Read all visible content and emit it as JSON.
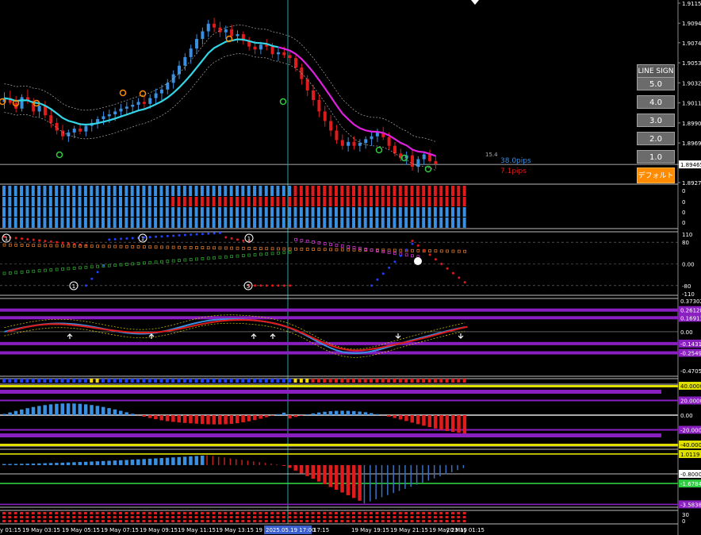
{
  "colors": {
    "background": "#000000",
    "bull": "#3a8fe0",
    "bear": "#e01b1b",
    "ma_fast": "#33d6e6",
    "ma_slow": "#e020e0",
    "crosshair": "#2fa0a0"
  },
  "price_axis": {
    "ticks": [
      "1.91155",
      "1.90945",
      "1.90740",
      "1.90530",
      "1.90320",
      "1.90110",
      "1.89900",
      "1.89690",
      "1.89465",
      "1.89275"
    ],
    "current": "1.89465"
  },
  "pips": {
    "up": "38.0pips",
    "down": "7.1pips",
    "spread": "15.4"
  },
  "buttons": {
    "header": "LINE SIGN",
    "b5": "5.0",
    "b4": "4.0",
    "b3": "3.0",
    "b2": "2.0",
    "b1": "1.0",
    "default": "デフォルト"
  },
  "strip_axis": [
    "0",
    "0",
    "0",
    "0"
  ],
  "osc1": {
    "ticks": [
      "110",
      "80",
      "0.00",
      "-80",
      "-110"
    ],
    "markers": [
      "1",
      "1",
      "1",
      "5",
      "1"
    ]
  },
  "osc2": {
    "ticks": [
      "0.37302",
      "0.26128",
      "0.16911",
      "0.00",
      "-0.14318",
      "-0.25492",
      "-0.47054"
    ]
  },
  "osc3": {
    "ticks": [
      "40.0000",
      "20.0000",
      "0.00",
      "-20.0000",
      "-40.0000"
    ]
  },
  "osc4": {
    "ticks": [
      "1.0119",
      "-0.8000",
      "-1.6784",
      "-3.5838"
    ]
  },
  "osc5": {
    "ticks": [
      "30",
      "0"
    ]
  },
  "time_axis": {
    "labels": [
      "y 01:15",
      "19 May 03:15",
      "19 May 05:15",
      "19 May 07:15",
      "19 May 09:15",
      "19 May 11:15",
      "19 May 13:15",
      "19 M",
      "17:15",
      "19 May 19:15",
      "19 May 21:15",
      "19 May 23:15",
      "20 May 01:15"
    ],
    "cursor": "2025.05.19 17:00"
  },
  "candles": [
    [
      1.9012,
      1.9022,
      1.9005,
      1.9016
    ],
    [
      1.9016,
      1.9024,
      1.9009,
      1.9011
    ],
    [
      1.9011,
      1.9018,
      1.9001,
      1.9005
    ],
    [
      1.9005,
      1.902,
      1.9002,
      1.9017
    ],
    [
      1.9017,
      1.9025,
      1.901,
      1.9013
    ],
    [
      1.9013,
      1.9016,
      1.8998,
      1.9002
    ],
    [
      1.9002,
      1.9011,
      1.8996,
      1.9008
    ],
    [
      1.9008,
      1.9013,
      1.8995,
      1.8998
    ],
    [
      1.8998,
      1.9004,
      1.8985,
      1.899
    ],
    [
      1.899,
      1.8995,
      1.8978,
      1.8982
    ],
    [
      1.8982,
      1.8988,
      1.8972,
      1.8976
    ],
    [
      1.8976,
      1.8983,
      1.897,
      1.898
    ],
    [
      1.898,
      1.8987,
      1.8974,
      1.8984
    ],
    [
      1.8984,
      1.899,
      1.8978,
      1.8981
    ],
    [
      1.8981,
      1.8989,
      1.8976,
      1.8987
    ],
    [
      1.8987,
      1.8994,
      1.8981,
      1.899
    ],
    [
      1.899,
      1.8997,
      1.8984,
      1.8994
    ],
    [
      1.8994,
      1.9002,
      1.8988,
      1.8997
    ],
    [
      1.8997,
      1.9004,
      1.899,
      1.8999
    ],
    [
      1.8999,
      1.9006,
      1.8992,
      1.9002
    ],
    [
      1.9002,
      1.901,
      1.8996,
      1.9005
    ],
    [
      1.9005,
      1.9012,
      1.8998,
      1.9007
    ],
    [
      1.9007,
      1.9014,
      1.9,
      1.9009
    ],
    [
      1.9009,
      1.9016,
      1.9002,
      1.9012
    ],
    [
      1.9012,
      1.9018,
      1.9004,
      1.901
    ],
    [
      1.901,
      1.902,
      1.9005,
      1.9016
    ],
    [
      1.9016,
      1.9026,
      1.901,
      1.9021
    ],
    [
      1.9021,
      1.903,
      1.9014,
      1.9025
    ],
    [
      1.9025,
      1.9036,
      1.902,
      1.9032
    ],
    [
      1.9032,
      1.9045,
      1.9026,
      1.9041
    ],
    [
      1.9041,
      1.9055,
      1.9036,
      1.905
    ],
    [
      1.905,
      1.9063,
      1.9045,
      1.9059
    ],
    [
      1.9059,
      1.9072,
      1.9052,
      1.9068
    ],
    [
      1.9068,
      1.9083,
      1.9062,
      1.9078
    ],
    [
      1.9078,
      1.909,
      1.9072,
      1.9086
    ],
    [
      1.9086,
      1.9098,
      1.908,
      1.9094
    ],
    [
      1.9094,
      1.91,
      1.9085,
      1.909
    ],
    [
      1.909,
      1.9096,
      1.908,
      1.9085
    ],
    [
      1.9085,
      1.9092,
      1.9078,
      1.9088
    ],
    [
      1.9088,
      1.9093,
      1.9077,
      1.9081
    ],
    [
      1.9081,
      1.9087,
      1.9074,
      1.9083
    ],
    [
      1.9083,
      1.9086,
      1.9072,
      1.9076
    ],
    [
      1.9076,
      1.908,
      1.9066,
      1.907
    ],
    [
      1.907,
      1.9076,
      1.9062,
      1.9067
    ],
    [
      1.9067,
      1.9075,
      1.9062,
      1.9072
    ],
    [
      1.9072,
      1.9078,
      1.9066,
      1.907
    ],
    [
      1.907,
      1.9074,
      1.9058,
      1.9062
    ],
    [
      1.9062,
      1.9068,
      1.9055,
      1.9064
    ],
    [
      1.9064,
      1.907,
      1.9058,
      1.9061
    ],
    [
      1.9061,
      1.9066,
      1.9052,
      1.9058
    ],
    [
      1.9058,
      1.9062,
      1.9044,
      1.9048
    ],
    [
      1.9048,
      1.9052,
      1.903,
      1.9036
    ],
    [
      1.9036,
      1.904,
      1.9018,
      1.9024
    ],
    [
      1.9024,
      1.903,
      1.9008,
      1.9014
    ],
    [
      1.9014,
      1.902,
      1.8996,
      1.9002
    ],
    [
      1.9002,
      1.9008,
      1.8986,
      1.8992
    ],
    [
      1.8992,
      1.8998,
      1.8976,
      1.8982
    ],
    [
      1.8982,
      1.8988,
      1.8968,
      1.8972
    ],
    [
      1.8972,
      1.8978,
      1.8962,
      1.8966
    ],
    [
      1.8966,
      1.8975,
      1.896,
      1.897
    ],
    [
      1.897,
      1.8976,
      1.8962,
      1.8966
    ],
    [
      1.8966,
      1.8973,
      1.896,
      1.8969
    ],
    [
      1.8969,
      1.8976,
      1.8963,
      1.8973
    ],
    [
      1.8973,
      1.898,
      1.8966,
      1.8976
    ],
    [
      1.8976,
      1.8984,
      1.897,
      1.898
    ],
    [
      1.898,
      1.8986,
      1.8972,
      1.8975
    ],
    [
      1.8975,
      1.898,
      1.8962,
      1.8966
    ],
    [
      1.8966,
      1.897,
      1.8955,
      1.8958
    ],
    [
      1.8958,
      1.8963,
      1.895,
      1.8953
    ],
    [
      1.8953,
      1.896,
      1.8946,
      1.8956
    ],
    [
      1.8956,
      1.8962,
      1.894,
      1.8944
    ],
    [
      1.8944,
      1.8955,
      1.8938,
      1.8952
    ],
    [
      1.8952,
      1.896,
      1.8946,
      1.8957
    ],
    [
      1.8957,
      1.8962,
      1.8948,
      1.895
    ],
    [
      1.895,
      1.8956,
      1.8942,
      1.8947
    ]
  ]
}
